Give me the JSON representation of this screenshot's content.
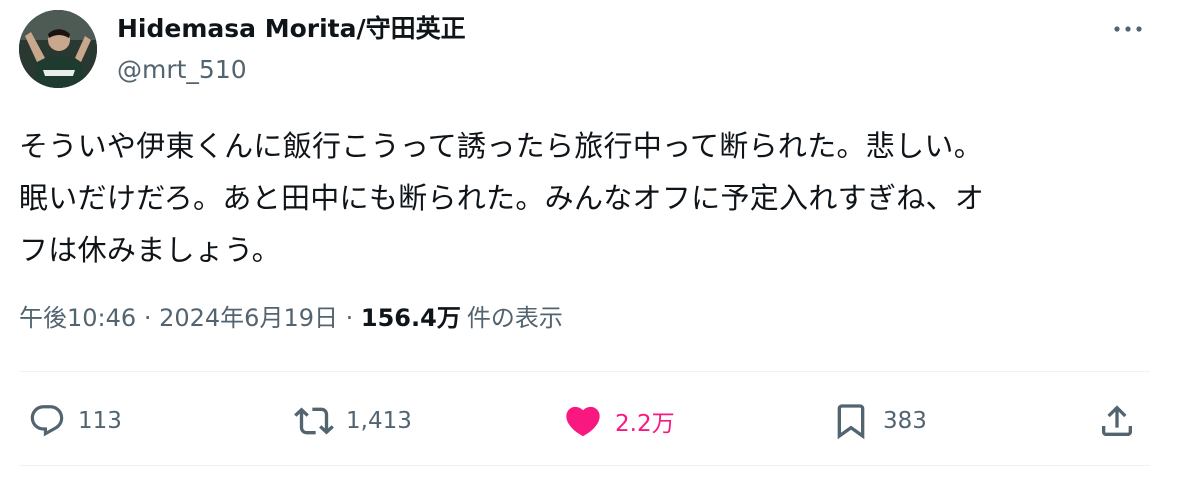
{
  "author": {
    "name": "Hidemasa Morita/守田英正",
    "handle": "@mrt_510",
    "avatar_icon": "profile-photo"
  },
  "tweet": {
    "text": "そういや伊東くんに飯行こうって誘ったら旅行中って断られた。悲しい。\n眠いだけだろ。あと田中にも断られた。みんなオフに予定入れすぎね、オ\nフは休みましょう。"
  },
  "meta": {
    "time": "午後10:46",
    "separator": "·",
    "date": "2024年6月19日",
    "views_count": "156.4万",
    "views_label": "件の表示"
  },
  "actions": {
    "reply": {
      "icon": "reply-icon",
      "count": "113"
    },
    "retweet": {
      "icon": "retweet-icon",
      "count": "1,413"
    },
    "like": {
      "icon": "heart-icon",
      "count": "2.2万",
      "active": true
    },
    "bookmark": {
      "icon": "bookmark-icon",
      "count": "383"
    },
    "share": {
      "icon": "share-icon"
    }
  },
  "colors": {
    "text_primary": "#0f1419",
    "text_secondary": "#536471",
    "like_active": "#f91880",
    "divider": "#eff3f4"
  }
}
